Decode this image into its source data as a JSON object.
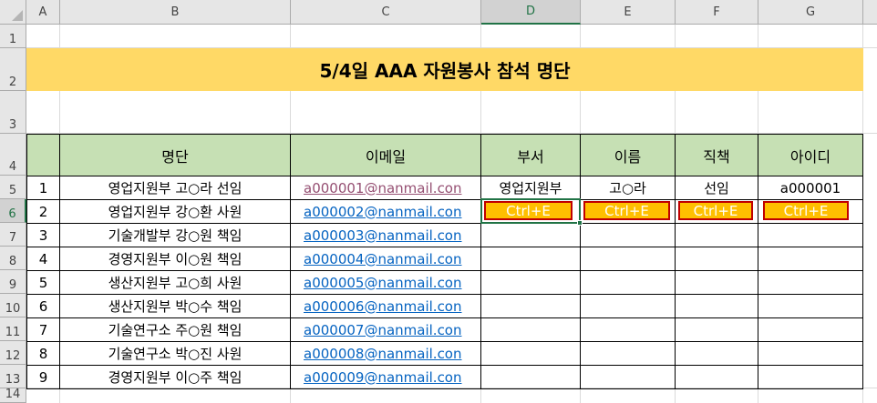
{
  "columns": [
    "A",
    "B",
    "C",
    "D",
    "E",
    "F",
    "G"
  ],
  "rows": [
    "1",
    "2",
    "3",
    "4",
    "5",
    "6",
    "7",
    "8",
    "9",
    "10",
    "11",
    "12",
    "13",
    "14"
  ],
  "title": "5/4일 AAA 자원봉사 참석 명단",
  "headers": {
    "roster": "명단",
    "email": "이메일",
    "dept": "부서",
    "name": "이름",
    "position": "직책",
    "id": "아이디"
  },
  "entries": [
    {
      "no": "1",
      "roster": "영업지원부 고○라 선임",
      "email": "a000001@nanmail.con"
    },
    {
      "no": "2",
      "roster": "영업지원부 강○환 사원",
      "email": "a000002@nanmail.con"
    },
    {
      "no": "3",
      "roster": "기술개발부 강○원 책임",
      "email": "a000003@nanmail.con"
    },
    {
      "no": "4",
      "roster": "경영지원부 이○원 책임",
      "email": "a000004@nanmail.con"
    },
    {
      "no": "5",
      "roster": "생산지원부 고○희 사원",
      "email": "a000005@nanmail.con"
    },
    {
      "no": "6",
      "roster": "생산지원부 박○수 책임",
      "email": "a000006@nanmail.con"
    },
    {
      "no": "7",
      "roster": "기술연구소 주○원 책임",
      "email": "a000007@nanmail.con"
    },
    {
      "no": "8",
      "roster": "기술연구소 박○진 사원",
      "email": "a000008@nanmail.con"
    },
    {
      "no": "9",
      "roster": "경영지원부 이○주 책임",
      "email": "a000009@nanmail.con"
    }
  ],
  "first_split": {
    "dept": "영업지원부",
    "name": "고○라",
    "position": "선임",
    "id": "a000001"
  },
  "shortcut_label": "Ctrl+E",
  "colors": {
    "title_fill": "#ffd966",
    "header_fill": "#c6e0b4",
    "shortcut_fill": "#ffc000",
    "shortcut_border": "#c00000",
    "selection": "#217346"
  },
  "active_cell": "D6"
}
